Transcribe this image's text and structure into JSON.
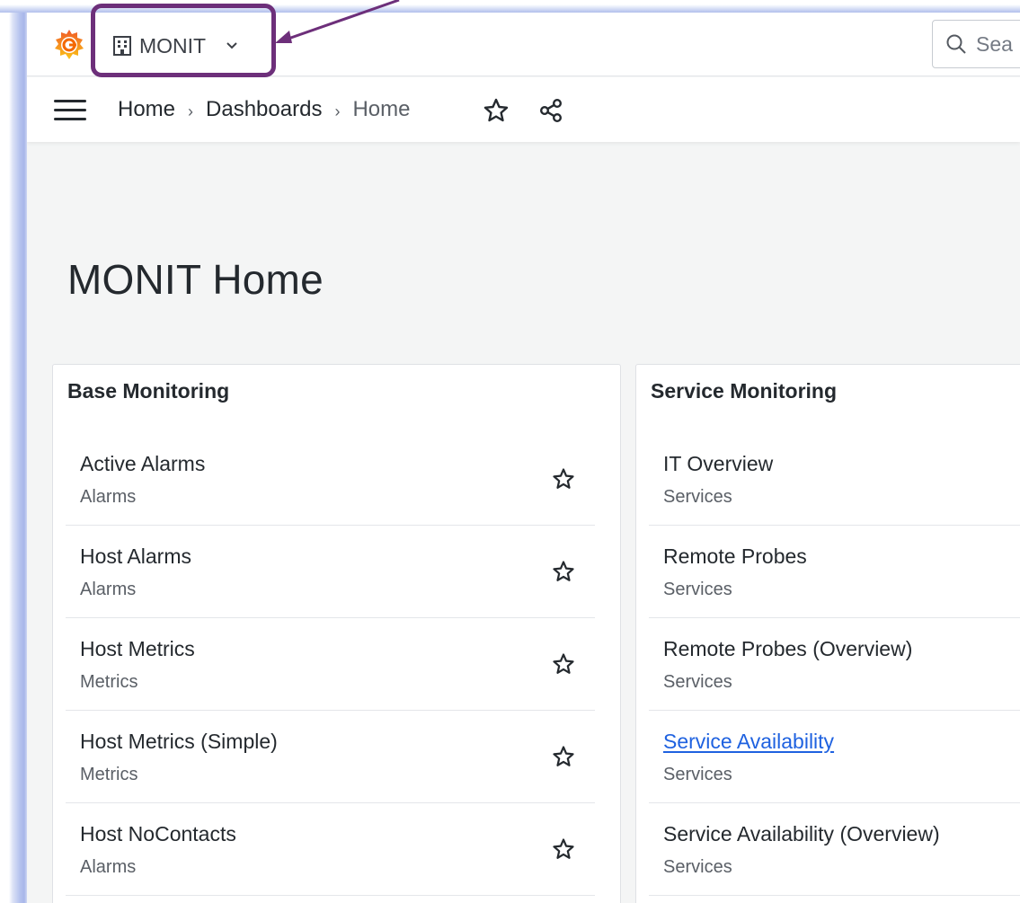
{
  "topbar": {
    "org_name": "MONIT",
    "search_placeholder": "Sea"
  },
  "breadcrumb": {
    "items": [
      "Home",
      "Dashboards",
      "Home"
    ]
  },
  "page": {
    "title": "MONIT Home"
  },
  "panels": [
    {
      "title": "Base Monitoring",
      "items": [
        {
          "title": "Active Alarms",
          "folder": "Alarms"
        },
        {
          "title": "Host Alarms",
          "folder": "Alarms"
        },
        {
          "title": "Host Metrics",
          "folder": "Metrics"
        },
        {
          "title": "Host Metrics (Simple)",
          "folder": "Metrics"
        },
        {
          "title": "Host NoContacts",
          "folder": "Alarms"
        }
      ]
    },
    {
      "title": "Service Monitoring",
      "items": [
        {
          "title": "IT Overview",
          "folder": "Services"
        },
        {
          "title": "Remote Probes",
          "folder": "Services"
        },
        {
          "title": "Remote Probes (Overview)",
          "folder": "Services"
        },
        {
          "title": "Service Availability",
          "folder": "Services",
          "hovered": true
        },
        {
          "title": "Service Availability (Overview)",
          "folder": "Services"
        }
      ]
    }
  ],
  "icons": {
    "logo": "grafana-logo",
    "org": "building-icon",
    "org_chevron": "chevron-down-icon",
    "search": "search-icon",
    "menu": "hamburger-menu-icon",
    "star": "star-outline-icon",
    "share": "share-icon"
  },
  "colors": {
    "annotation": "#6d2f7a",
    "link": "#1f62e0",
    "logo_orange": "#f46800",
    "logo_yellow": "#fbc318"
  }
}
